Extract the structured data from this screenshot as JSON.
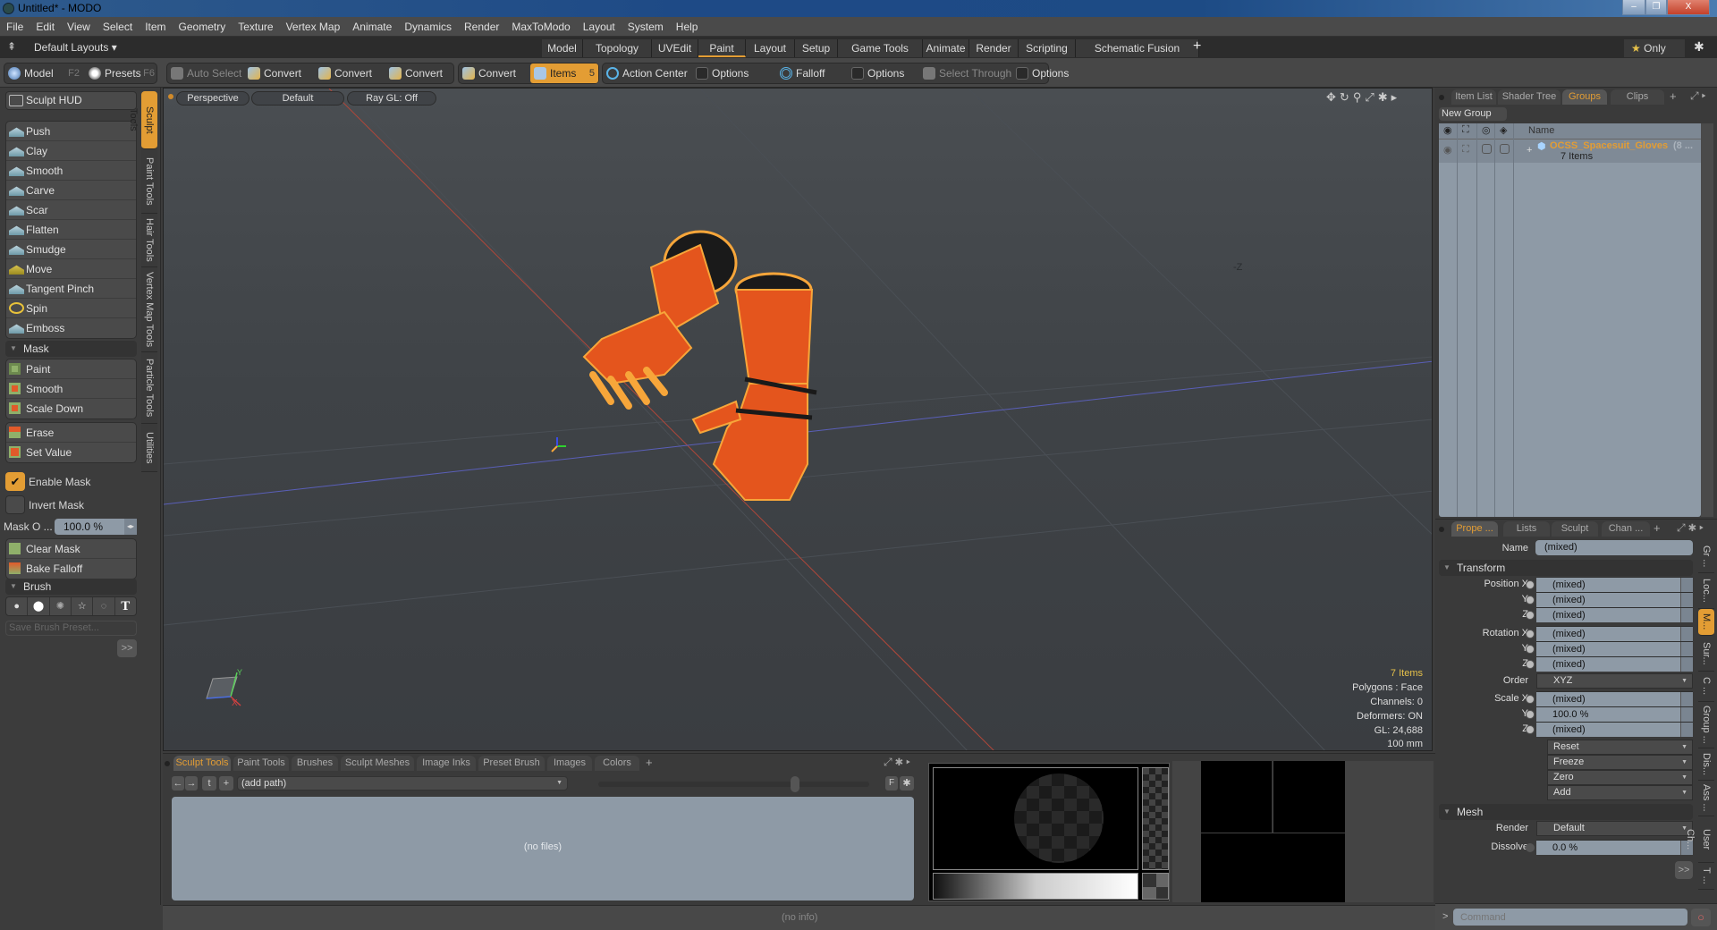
{
  "window": {
    "title": "Untitled* - MODO",
    "minimize": "–",
    "restore": "❐",
    "close": "X"
  },
  "menu": [
    "File",
    "Edit",
    "View",
    "Select",
    "Item",
    "Geometry",
    "Texture",
    "Vertex Map",
    "Animate",
    "Dynamics",
    "Render",
    "MaxToModo",
    "Layout",
    "System",
    "Help"
  ],
  "layouts": {
    "dropdown": "Default Layouts ▾",
    "tabs": [
      "Model",
      "Topology",
      "UVEdit",
      "Paint",
      "Layout",
      "Setup",
      "Game Tools",
      "Animate",
      "Render",
      "Scripting",
      "Schematic Fusion"
    ],
    "active": "Paint",
    "add": "+",
    "only": "Only"
  },
  "toolbar": {
    "model": "Model",
    "model_key": "F2",
    "presets": "Presets",
    "presets_key": "F6",
    "auto_select": "Auto Select",
    "convert1": "Convert",
    "convert2": "Convert",
    "convert3": "Convert",
    "convert4": "Convert",
    "items": "Items",
    "items_key": "5",
    "action_center": "Action Center",
    "options1": "Options",
    "falloff": "Falloff",
    "options2": "Options",
    "select_through": "Select Through",
    "options3": "Options"
  },
  "left_panel": {
    "sculpt_hud": "Sculpt HUD",
    "tools": [
      "Push",
      "Clay",
      "Smooth",
      "Carve",
      "Scar",
      "Flatten",
      "Smudge",
      "Move",
      "Tangent Pinch",
      "Spin",
      "Emboss"
    ],
    "mask_section": "Mask",
    "mask_tools": [
      "Paint",
      "Smooth",
      "Scale Down"
    ],
    "mask_tools2": [
      "Erase",
      "Set Value"
    ],
    "enable_mask": "Enable Mask",
    "enable_mask_checked": true,
    "invert_mask": "Invert Mask",
    "mask_opacity_label": "Mask O ...",
    "mask_opacity_value": "100.0 %",
    "clear_mask": "Clear Mask",
    "bake_falloff": "Bake Falloff",
    "brush_section": "Brush",
    "save_brush_preset": "Save Brush Preset...",
    "more": ">>",
    "vertical_tabs": [
      "Sculpt Tools",
      "Paint Tools",
      "Hair Tools",
      "Vertex Map Tools",
      "Particle Tools",
      "Utilities"
    ],
    "vertical_tab_active": "Sculpt Tools"
  },
  "viewport": {
    "view": "Perspective",
    "shading": "Default",
    "raygl": "Ray GL: Off",
    "axis_label": "-Z",
    "info": {
      "items": "7 Items",
      "polygons": "Polygons : Face",
      "channels": "Channels: 0",
      "deformers": "Deformers: ON",
      "gl": "GL: 24,688",
      "scale": "100 mm"
    },
    "gizmo": {
      "x": "X",
      "y": "Y",
      "z": "Z"
    }
  },
  "groups_panel": {
    "tabs": [
      "Item List",
      "Shader Tree",
      "Groups",
      "Clips"
    ],
    "active": "Groups",
    "new_group": "New Group",
    "column_name": "Name",
    "group_name": "OCSS_Spacesuit_Gloves",
    "group_suffix": "(8 ...",
    "group_count": "7 Items"
  },
  "properties": {
    "tabs": [
      "Prope ...",
      "Lists",
      "Sculpt",
      "Chan ..."
    ],
    "active": "Prope ...",
    "name_label": "Name",
    "name_value": "(mixed)",
    "transform": "Transform",
    "rows": [
      {
        "label": "Position X",
        "value": "(mixed)"
      },
      {
        "label": "Y",
        "value": "(mixed)"
      },
      {
        "label": "Z",
        "value": "(mixed)"
      },
      {
        "label": "Rotation X",
        "value": "(mixed)"
      },
      {
        "label": "Y",
        "value": "(mixed)"
      },
      {
        "label": "Z",
        "value": "(mixed)"
      }
    ],
    "order_label": "Order",
    "order_value": "XYZ",
    "scale_rows": [
      {
        "label": "Scale X",
        "value": "(mixed)"
      },
      {
        "label": "Y",
        "value": "100.0 %"
      },
      {
        "label": "Z",
        "value": "(mixed)"
      }
    ],
    "actions": [
      "Reset",
      "Freeze",
      "Zero",
      "Add"
    ],
    "mesh": "Mesh",
    "render_label": "Render",
    "render_value": "Default",
    "dissolve_label": "Dissolve",
    "dissolve_value": "0.0 %",
    "more": ">>",
    "side_tabs": [
      "Gr ...",
      "Loc...",
      "M...",
      "Sur...",
      "C ...",
      "Group ...",
      "Dis...",
      "Ass ...",
      "User Ch...",
      "T ..."
    ],
    "side_tab_active": "M..."
  },
  "bottom": {
    "tabs": [
      "Sculpt Tools",
      "Paint Tools",
      "Brushes",
      "Sculpt Meshes",
      "Image Inks",
      "Preset Brush",
      "Images",
      "Colors"
    ],
    "active": "Sculpt Tools",
    "add": "+",
    "path": "(add path)",
    "no_files": "(no files)",
    "f_button": "F"
  },
  "status": {
    "info": "(no info)"
  },
  "command": {
    "placeholder": "Command",
    "prompt": ">"
  }
}
